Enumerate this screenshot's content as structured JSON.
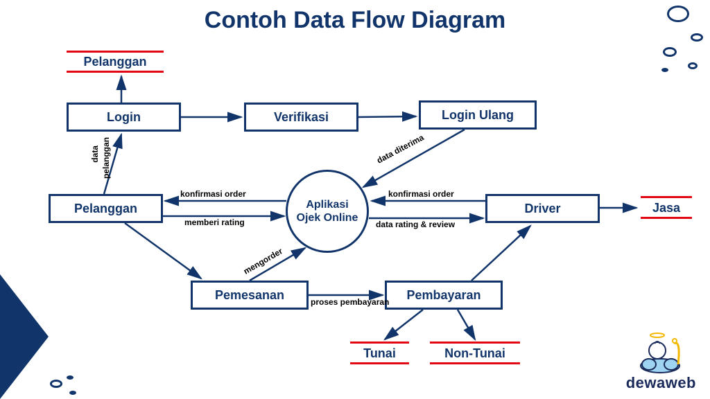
{
  "title": "Contoh Data Flow Diagram",
  "nodes": {
    "login": "Login",
    "verifikasi": "Verifikasi",
    "login_ulang": "Login Ulang",
    "pelanggan_box": "Pelanggan",
    "driver_box": "Driver",
    "pemesanan": "Pemesanan",
    "pembayaran": "Pembayaran",
    "aplikasi": "Aplikasi\nOjek Online"
  },
  "externals": {
    "pelanggan": "Pelanggan",
    "jasa": "Jasa",
    "tunai": "Tunai",
    "non_tunai": "Non-Tunai"
  },
  "edges": {
    "data_pelanggan1": "data",
    "data_pelanggan2": "pelanggan",
    "data_diterima": "data diterima",
    "konfirmasi_order_left": "konfirmasi order",
    "memberi_rating": "memberi rating",
    "konfirmasi_order_right": "konfirmasi order",
    "data_rating_review": "data rating & review",
    "mengorder": "mengorder",
    "proses_pembayaran": "proses pembayaran"
  },
  "brand": "dewaweb",
  "colors": {
    "primary": "#11356a",
    "accent": "#e30613"
  }
}
